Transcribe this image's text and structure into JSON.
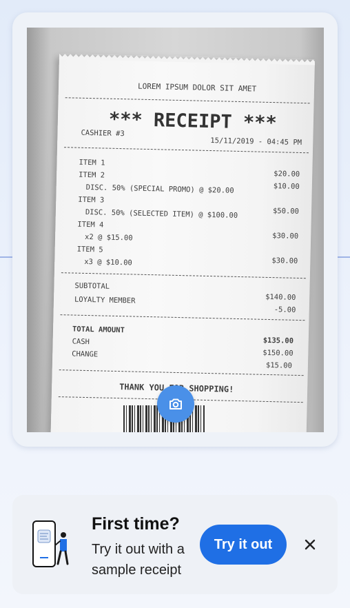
{
  "receipt": {
    "header": "LOREM IPSUM DOLOR SIT AMET",
    "title": "*** RECEIPT ***",
    "cashier": "CASHIER #3",
    "datetime": "15/11/2019 - 04:45 PM",
    "lines": [
      {
        "label": "ITEM 1",
        "amount": "$20.00"
      },
      {
        "label": "ITEM 2",
        "amount": "$10.00"
      },
      {
        "label": "DISC. 50% (SPECIAL PROMO) @ $20.00",
        "amount": ""
      },
      {
        "label": "ITEM 3",
        "amount": "$50.00"
      },
      {
        "label": "DISC. 50% (SELECTED ITEM) @ $100.00",
        "amount": ""
      },
      {
        "label": "ITEM 4",
        "amount": "$30.00"
      },
      {
        "label": "x2 @ $15.00",
        "amount": ""
      },
      {
        "label": "ITEM 5",
        "amount": "$30.00"
      },
      {
        "label": "x3 @ $10.00",
        "amount": ""
      }
    ],
    "subtotal_label": "SUBTOTAL",
    "subtotal": "$140.00",
    "loyalty_label": "LOYALTY MEMBER",
    "loyalty": "-5.00",
    "total_label": "TOTAL AMOUNT",
    "total": "$135.00",
    "cash_label": "CASH",
    "cash": "$150.00",
    "change_label": "CHANGE",
    "change": "$15.00",
    "footer": "THANK YOU FOR SHOPPING!"
  },
  "camera_button": {
    "icon": "camera-icon"
  },
  "banner": {
    "title": "First time?",
    "subtitle": "Try it out with a sample receipt",
    "cta_label": "Try it out",
    "close_icon": "close-icon",
    "accent": "#1f6fe5"
  }
}
